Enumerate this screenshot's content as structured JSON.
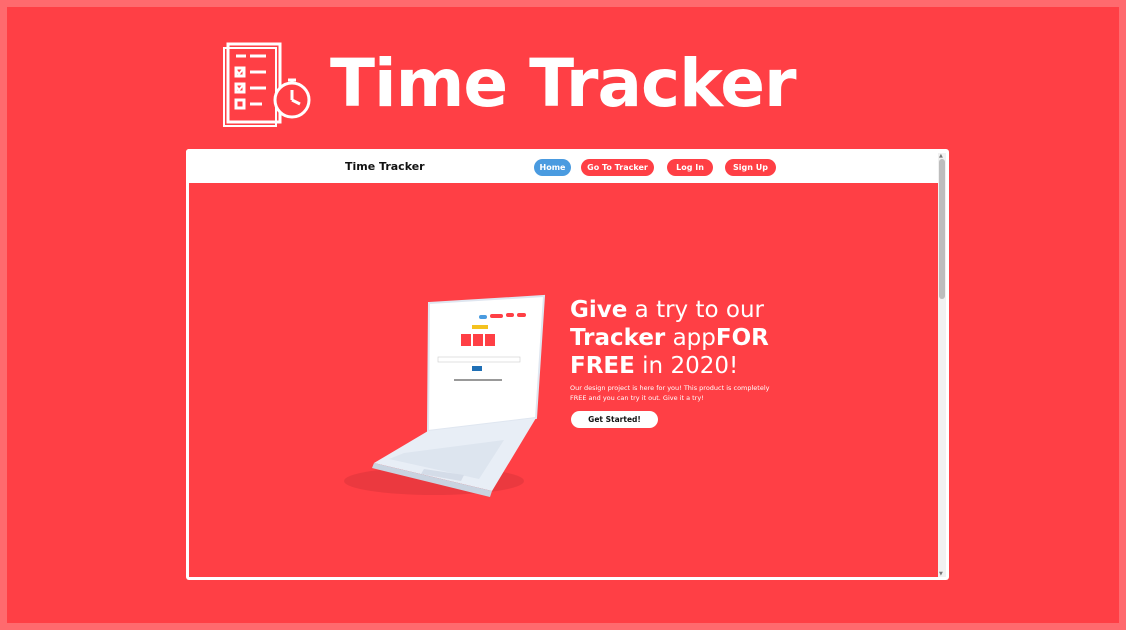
{
  "banner": {
    "title": "Time Tracker",
    "logo_icon": "checklist-stopwatch-icon"
  },
  "navbar": {
    "brand": "Time Tracker",
    "items": [
      {
        "label": "Home",
        "active": true
      },
      {
        "label": "Go To Tracker",
        "active": false
      },
      {
        "label": "Log In",
        "active": false
      },
      {
        "label": "Sign Up",
        "active": false
      }
    ]
  },
  "hero": {
    "heading_part1_bold": "Give",
    "heading_part1": " a try to our",
    "heading_part2_bold": "Tracker",
    "heading_part2": " app",
    "heading_part2_bold_end": "FOR",
    "heading_part3_bold": "FREE",
    "heading_part3": " in 2020!",
    "description": "Our design project is here for you! This product is completely FREE and you can try it out. Give it a try!",
    "cta_label": "Get Started!"
  },
  "colors": {
    "primary": "#ff3f45",
    "active_nav": "#4a9be0",
    "white": "#ffffff"
  }
}
